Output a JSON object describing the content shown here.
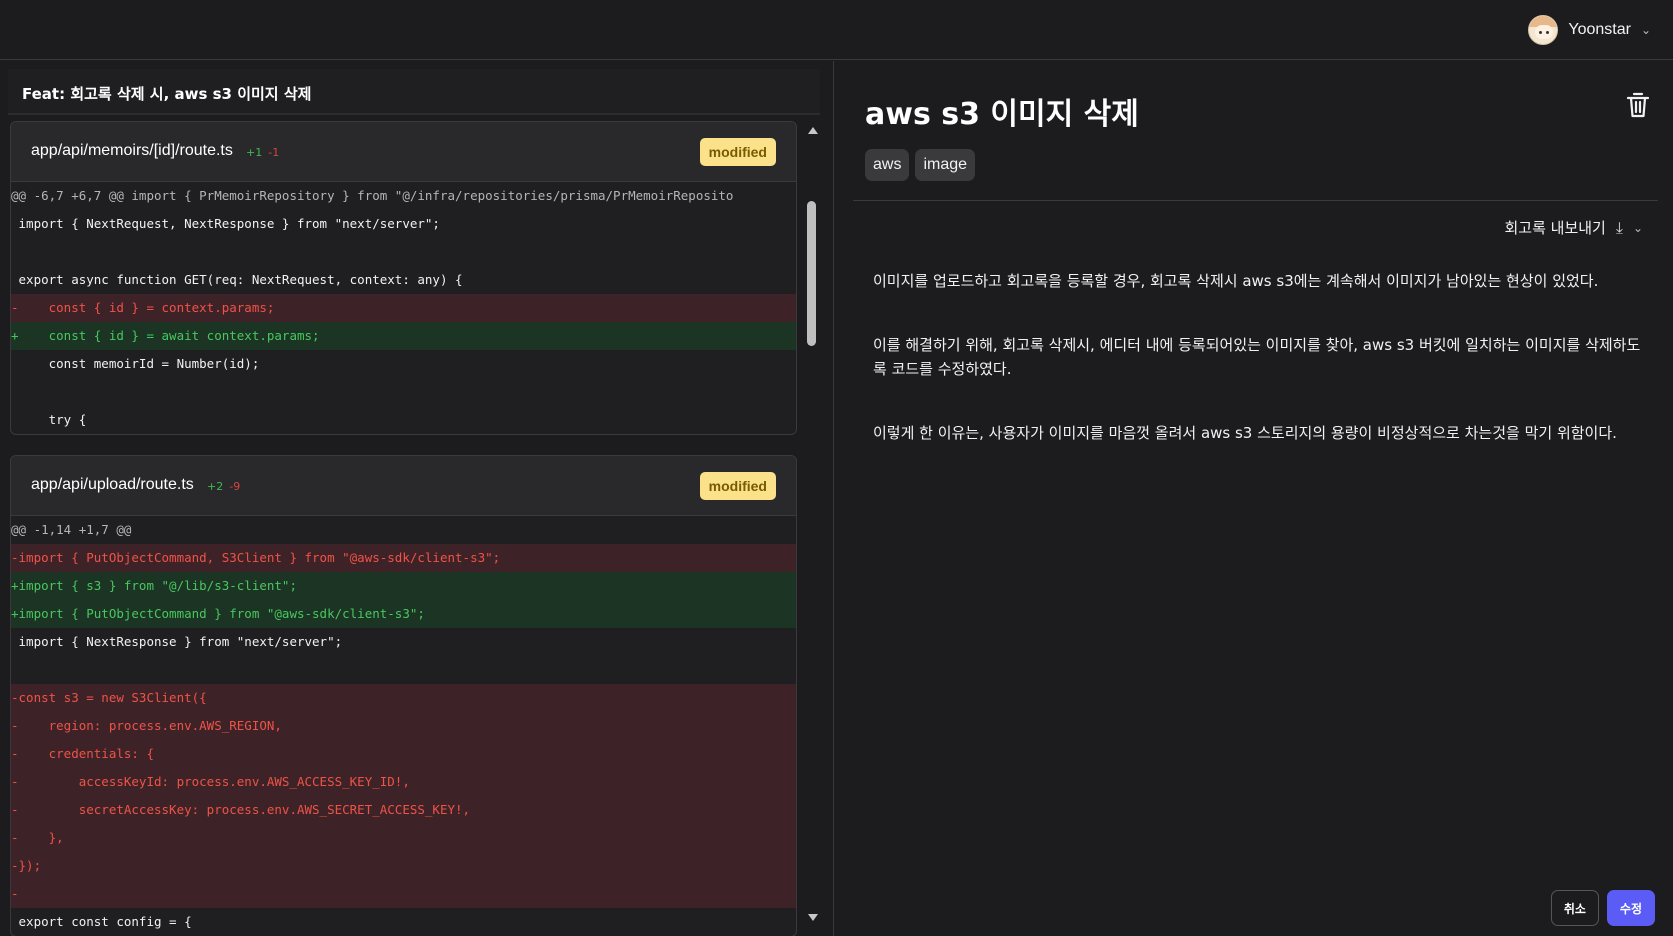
{
  "header": {
    "user_name": "Yoonstar",
    "avatar_icon": "avatar",
    "menu_icon": "chevron-down-icon"
  },
  "commit": {
    "title": "Feat: 회고록 삭제 시, aws s3 이미지 삭제"
  },
  "files": [
    {
      "path": "app/api/memoirs/[id]/route.ts",
      "additions": "+1",
      "deletions": "-1",
      "status": "modified",
      "lines": [
        {
          "type": "hunk",
          "text": "@@ -6,7 +6,7 @@ import { PrMemoirRepository } from \"@/infra/repositories/prisma/PrMemoirReposito"
        },
        {
          "type": "ctx",
          "text": " import { NextRequest, NextResponse } from \"next/server\";"
        },
        {
          "type": "ctx",
          "text": " "
        },
        {
          "type": "ctx",
          "text": " export async function GET(req: NextRequest, context: any) {"
        },
        {
          "type": "del",
          "text": "-    const { id } = context.params;"
        },
        {
          "type": "add",
          "text": "+    const { id } = await context.params;"
        },
        {
          "type": "ctx",
          "text": "     const memoirId = Number(id);"
        },
        {
          "type": "ctx",
          "text": " "
        },
        {
          "type": "ctx",
          "text": "     try {"
        }
      ]
    },
    {
      "path": "app/api/upload/route.ts",
      "additions": "+2",
      "deletions": "-9",
      "status": "modified",
      "lines": [
        {
          "type": "hunk",
          "text": "@@ -1,14 +1,7 @@"
        },
        {
          "type": "del",
          "text": "-import { PutObjectCommand, S3Client } from \"@aws-sdk/client-s3\";"
        },
        {
          "type": "add",
          "text": "+import { s3 } from \"@/lib/s3-client\";"
        },
        {
          "type": "add",
          "text": "+import { PutObjectCommand } from \"@aws-sdk/client-s3\";"
        },
        {
          "type": "ctx",
          "text": " import { NextResponse } from \"next/server\";"
        },
        {
          "type": "ctx",
          "text": " "
        },
        {
          "type": "del",
          "text": "-const s3 = new S3Client({"
        },
        {
          "type": "del",
          "text": "-    region: process.env.AWS_REGION,"
        },
        {
          "type": "del",
          "text": "-    credentials: {"
        },
        {
          "type": "del",
          "text": "-        accessKeyId: process.env.AWS_ACCESS_KEY_ID!,"
        },
        {
          "type": "del",
          "text": "-        secretAccessKey: process.env.AWS_SECRET_ACCESS_KEY!,"
        },
        {
          "type": "del",
          "text": "-    },"
        },
        {
          "type": "del",
          "text": "-});"
        },
        {
          "type": "del",
          "text": "-"
        },
        {
          "type": "ctx",
          "text": " export const config = {"
        }
      ]
    }
  ],
  "memo": {
    "title": "aws s3 이미지 삭제",
    "tags": [
      "aws",
      "image"
    ],
    "export_label": "회고록 내보내기",
    "export_icon": "download-icon",
    "delete_icon": "trash-icon",
    "paragraphs": [
      "이미지를 업로드하고 회고록을 등록할 경우, 회고록 삭제시 aws s3에는 계속해서 이미지가 남아있는 현상이 있었다.",
      "이를 해결하기 위해, 회고록 삭제시, 에디터 내에 등록되어있는 이미지를 찾아, aws s3 버킷에 일치하는 이미지를 삭제하도록 코드를 수정하였다.",
      "이렇게 한 이유는, 사용자가 이미지를 마음껏 올려서 aws s3 스토리지의 용량이 비정상적으로 차는것을 막기 위함이다."
    ]
  },
  "actions": {
    "cancel_label": "취소",
    "save_label": "수정"
  },
  "colors": {
    "accent": "#5b5cf6",
    "badge_bg": "#fbe28a",
    "add_bg": "#1c3424",
    "del_bg": "#3d2327"
  }
}
